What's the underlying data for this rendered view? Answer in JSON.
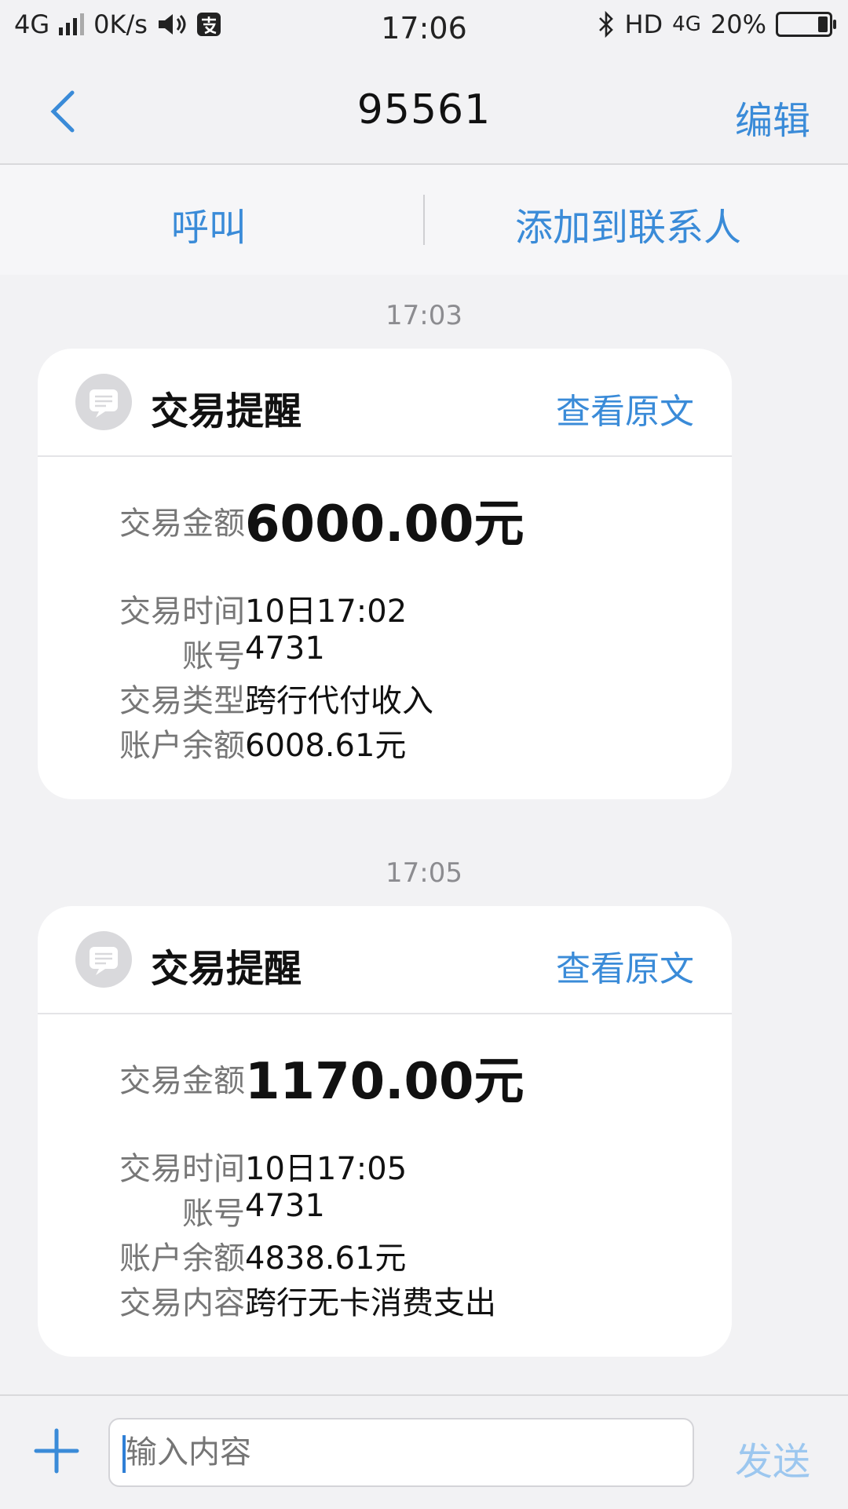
{
  "status_bar": {
    "network": "4G",
    "speed": "0K/s",
    "time": "17:06",
    "right_text": "HD",
    "right_network": "4G",
    "battery": "20%",
    "battery_level_percent": 20
  },
  "header": {
    "title": "95561",
    "edit_label": "编辑"
  },
  "actions": {
    "call_label": "呼叫",
    "add_contact_label": "添加到联系人"
  },
  "messages": [
    {
      "timestamp": "17:03",
      "title": "交易提醒",
      "view_original": "查看原文",
      "amount_label": "交易金额",
      "amount": "6000.00元",
      "rows": [
        {
          "label": "交易时间",
          "value": "10日17:02"
        },
        {
          "label": "账号",
          "value": "4731"
        },
        {
          "label": "交易类型",
          "value": "跨行代付收入"
        },
        {
          "label": "账户余额",
          "value": "6008.61元"
        }
      ]
    },
    {
      "timestamp": "17:05",
      "title": "交易提醒",
      "view_original": "查看原文",
      "amount_label": "交易金额",
      "amount": "1170.00元",
      "rows": [
        {
          "label": "交易时间",
          "value": "10日17:05"
        },
        {
          "label": "账号",
          "value": "4731"
        },
        {
          "label": "账户余额",
          "value": "4838.61元"
        },
        {
          "label": "交易内容",
          "value": "跨行无卡消费支出"
        }
      ]
    }
  ],
  "composer": {
    "placeholder": "输入内容",
    "send_label": "发送"
  },
  "colors": {
    "accent": "#3a8bd8",
    "send_disabled": "#9cc7ef",
    "background": "#f2f2f4",
    "card": "#ffffff"
  }
}
